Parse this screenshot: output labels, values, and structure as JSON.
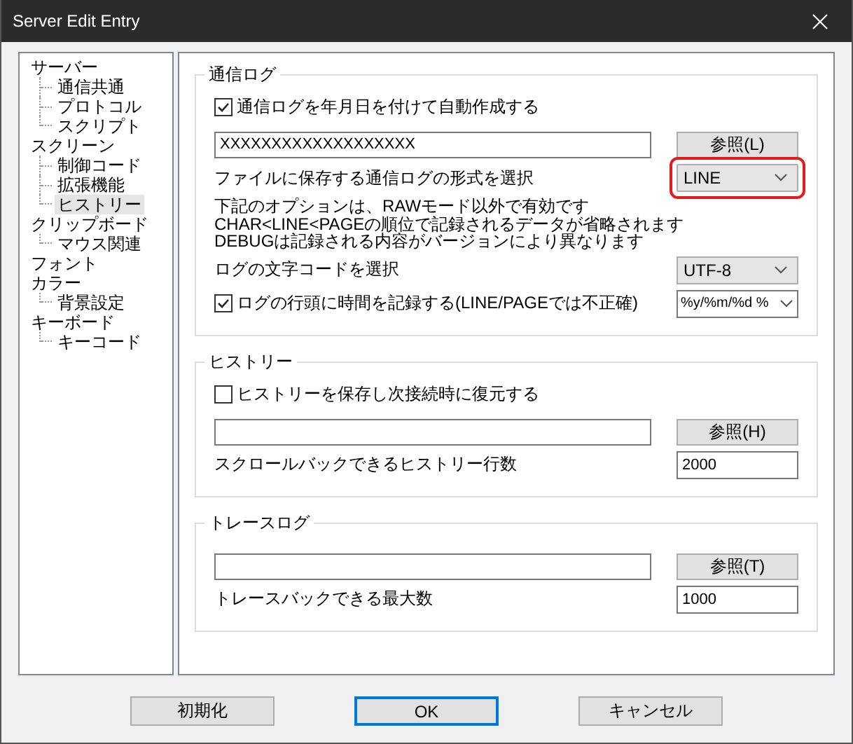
{
  "window": {
    "title": "Server Edit Entry"
  },
  "tree": [
    {
      "label": "サーバー",
      "selected": false,
      "children": [
        {
          "label": "通信共通",
          "selected": false
        },
        {
          "label": "プロトコル",
          "selected": false
        },
        {
          "label": "スクリプト",
          "selected": false
        }
      ]
    },
    {
      "label": "スクリーン",
      "selected": false,
      "children": [
        {
          "label": "制御コード",
          "selected": false
        },
        {
          "label": "拡張機能",
          "selected": false
        },
        {
          "label": "ヒストリー",
          "selected": true
        }
      ]
    },
    {
      "label": "クリップボード",
      "selected": false,
      "children": [
        {
          "label": "マウス関連",
          "selected": false
        }
      ]
    },
    {
      "label": "フォント",
      "selected": false
    },
    {
      "label": "カラー",
      "selected": false,
      "children": [
        {
          "label": "背景設定",
          "selected": false
        }
      ]
    },
    {
      "label": "キーボード",
      "selected": false,
      "children": [
        {
          "label": "キーコード",
          "selected": false
        }
      ]
    }
  ],
  "groups": [
    {
      "title": "通信ログ",
      "rows": [
        {
          "kind": "checkbox",
          "label": "通信ログを年月日を付けて自動作成する",
          "checked": true
        },
        {
          "kind": "path",
          "value": "XXXXXXXXXXXXXXXXXXX",
          "button": "参照(L)"
        },
        {
          "kind": "select",
          "label": "ファイルに保存する通信ログの形式を選択",
          "value": "LINE",
          "highlighted": true
        },
        {
          "kind": "note",
          "lines": [
            "下記のオプションは、RAWモード以外で有効です",
            "CHAR<LINE<PAGEの順位で記録されるデータが省略されます",
            "DEBUGは記録される内容がバージョンにより異なります"
          ]
        },
        {
          "kind": "select",
          "label": "ログの文字コードを選択",
          "value": "UTF-8",
          "highlighted": false
        },
        {
          "kind": "checkselect",
          "label": "ログの行頭に時間を記録する(LINE/PAGEでは不正確)",
          "checked": true,
          "value": "%y/%m/%d %"
        }
      ]
    },
    {
      "title": "ヒストリー",
      "rows": [
        {
          "kind": "checkbox",
          "label": "ヒストリーを保存し次接続時に復元する",
          "checked": false
        },
        {
          "kind": "path",
          "value": "",
          "button": "参照(H)"
        },
        {
          "kind": "number",
          "label": "スクロールバックできるヒストリー行数",
          "value": "2000"
        }
      ]
    },
    {
      "title": "トレースログ",
      "rows": [
        {
          "kind": "path",
          "value": "",
          "button": "参照(T)"
        },
        {
          "kind": "number",
          "label": "トレースバックできる最大数",
          "value": "1000"
        }
      ]
    }
  ],
  "buttons": [
    {
      "label": "初期化",
      "default": false
    },
    {
      "label": "OK",
      "default": true
    },
    {
      "label": "キャンセル",
      "default": false
    }
  ]
}
